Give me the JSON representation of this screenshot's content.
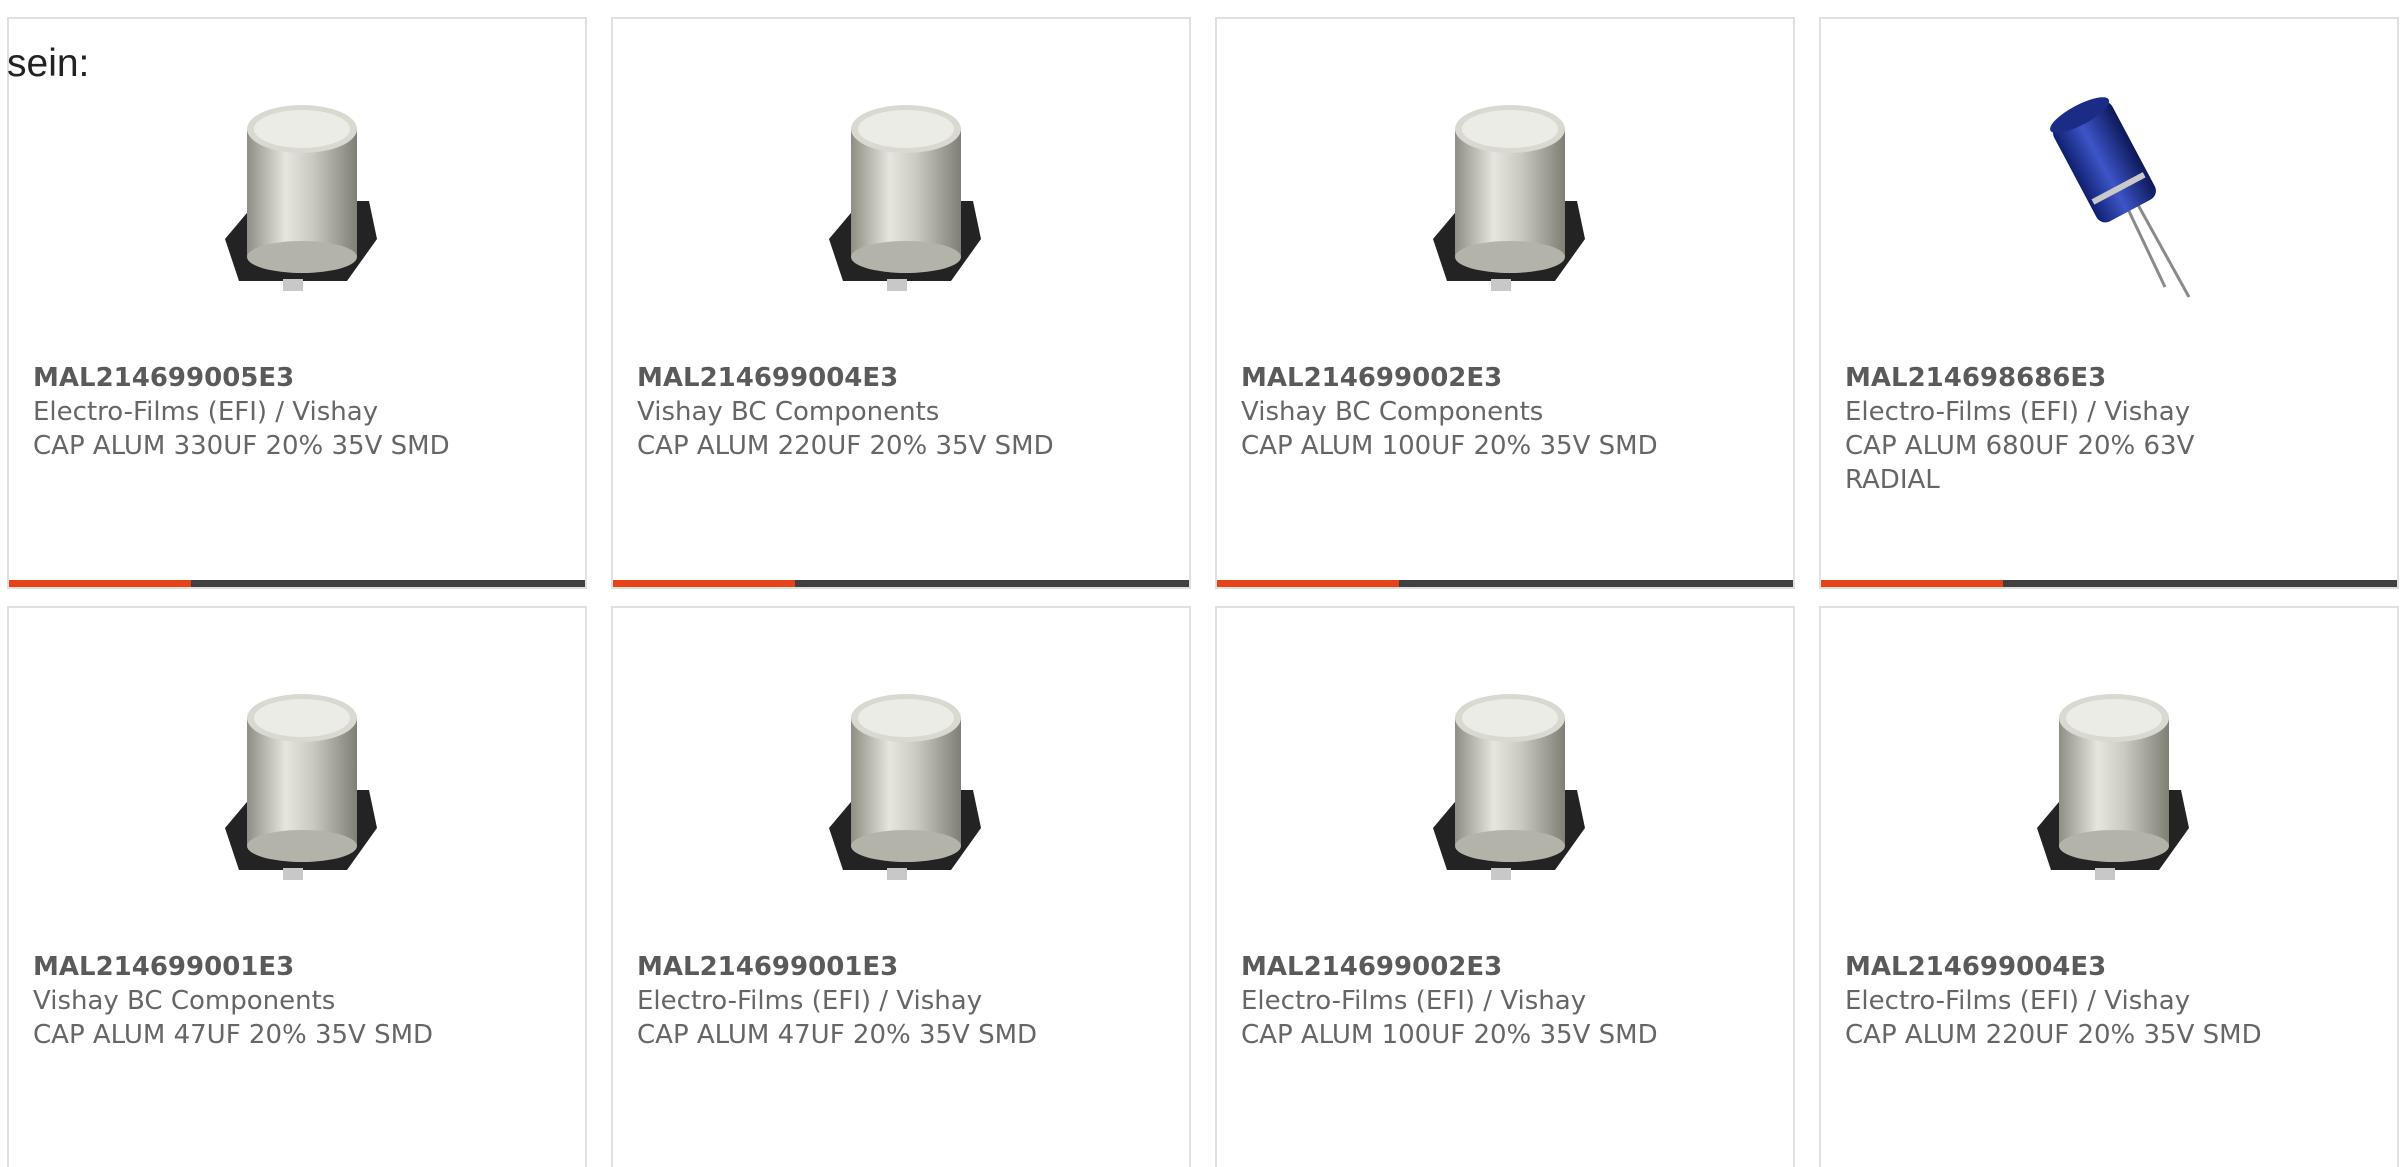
{
  "intro_text": "sein:",
  "accent_color": "#e8421b",
  "bar_track_color": "#404040",
  "products": [
    {
      "part": "MAL214699005E3",
      "manufacturer": "Electro-Films (EFI) / Vishay",
      "description": "CAP ALUM 330UF 20% 35V SMD",
      "image": "smd-capacitor-icon"
    },
    {
      "part": "MAL214699004E3",
      "manufacturer": "Vishay BC Components",
      "description": "CAP ALUM 220UF 20% 35V SMD",
      "image": "smd-capacitor-icon"
    },
    {
      "part": "MAL214699002E3",
      "manufacturer": "Vishay BC Components",
      "description": "CAP ALUM 100UF 20% 35V SMD",
      "image": "smd-capacitor-icon"
    },
    {
      "part": "MAL214698686E3",
      "manufacturer": "Electro-Films (EFI) / Vishay",
      "description": "CAP ALUM 680UF 20% 63V RADIAL",
      "image": "radial-capacitor-icon"
    },
    {
      "part": "MAL214699001E3",
      "manufacturer": "Vishay BC Components",
      "description": "CAP ALUM 47UF 20% 35V SMD",
      "image": "smd-capacitor-icon"
    },
    {
      "part": "MAL214699001E3",
      "manufacturer": "Electro-Films (EFI) / Vishay",
      "description": "CAP ALUM 47UF 20% 35V SMD",
      "image": "smd-capacitor-icon"
    },
    {
      "part": "MAL214699002E3",
      "manufacturer": "Electro-Films (EFI) / Vishay",
      "description": "CAP ALUM 100UF 20% 35V SMD",
      "image": "smd-capacitor-icon"
    },
    {
      "part": "MAL214699004E3",
      "manufacturer": "Electro-Films (EFI) / Vishay",
      "description": "CAP ALUM 220UF 20% 35V SMD",
      "image": "smd-capacitor-icon"
    }
  ]
}
